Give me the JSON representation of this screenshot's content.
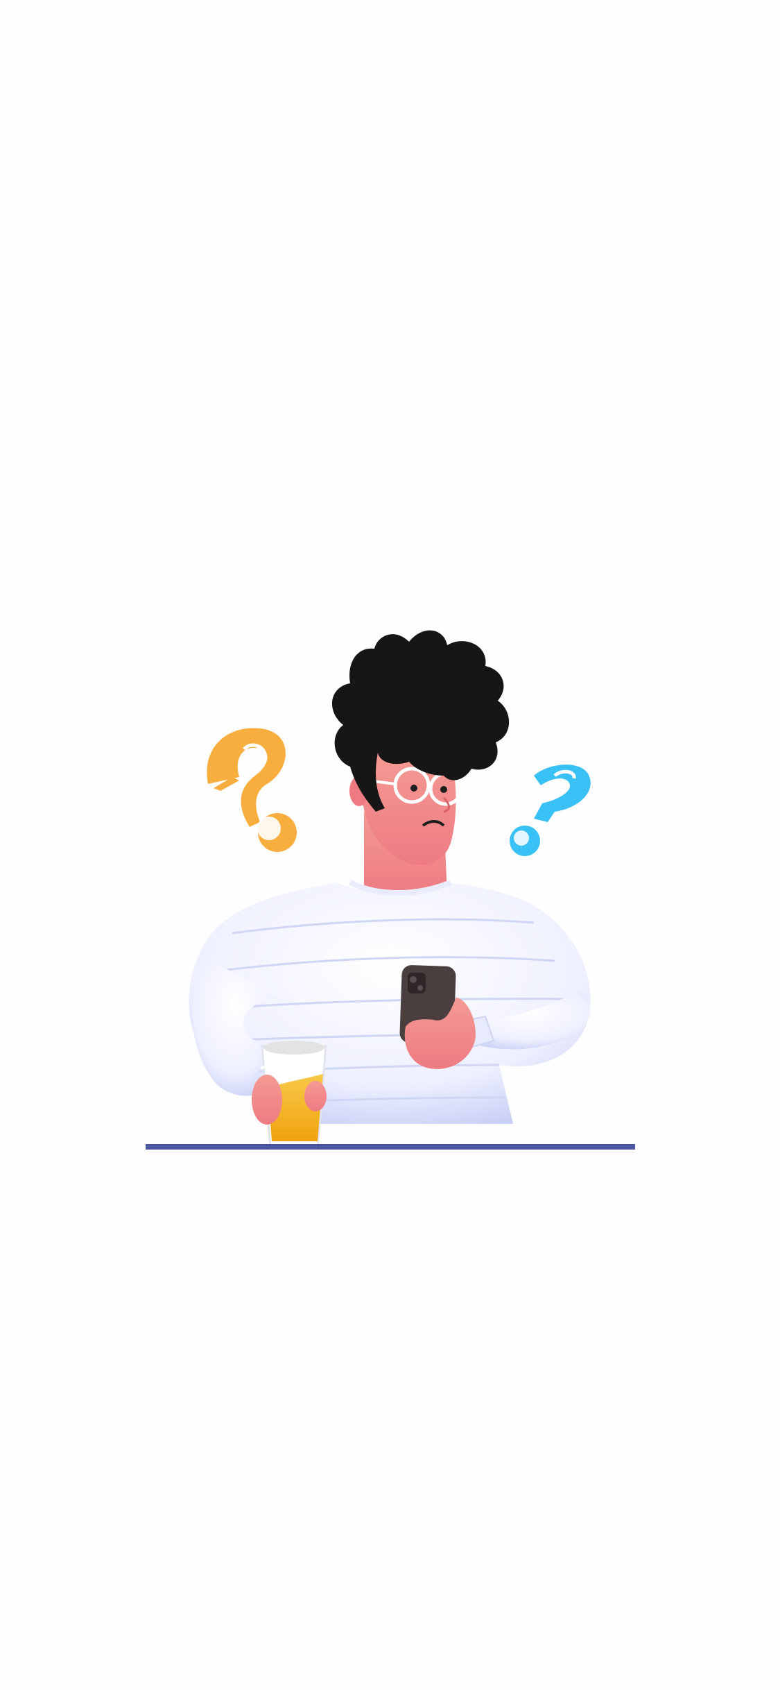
{
  "screen": {
    "background": "#fefefe"
  },
  "illustration": {
    "subject": "confused-person-with-phone-icon",
    "colors": {
      "question_mark_left": "#f8ad3f",
      "question_mark_right": "#39c0f4",
      "hair": "#161616",
      "skin": "#f2868a",
      "sweater": "#f3f5ff",
      "sweater_stripes": "#cfd6f4",
      "phone": "#4a3f3e",
      "drink": "#f4b31a",
      "ground_line": "#4a56a0"
    }
  }
}
